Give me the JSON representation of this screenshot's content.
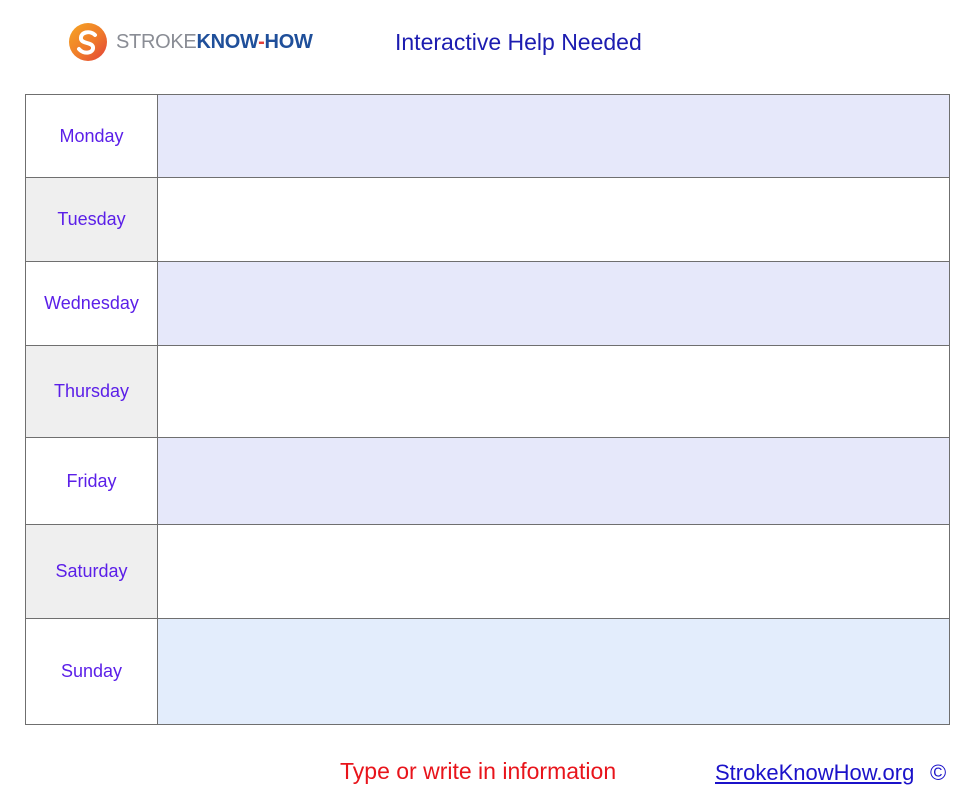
{
  "header": {
    "logo": {
      "stroke": "STROKE",
      "know": "KNOW",
      "dash": "-",
      "how": "HOW"
    },
    "title": "Interactive Help Needed"
  },
  "planner": {
    "days": [
      {
        "label": "Monday"
      },
      {
        "label": "Tuesday"
      },
      {
        "label": "Wednesday"
      },
      {
        "label": "Thursday"
      },
      {
        "label": "Friday"
      },
      {
        "label": "Saturday"
      },
      {
        "label": "Sunday"
      }
    ]
  },
  "footer": {
    "instruction": "Type or write in information",
    "link": "StrokeKnowHow.org",
    "copyright": "©"
  },
  "colors": {
    "title": "#1c1cb0",
    "day_label": "#5b1fe8",
    "instruction": "#e8141b",
    "link": "#1b12c9",
    "row_lavender": "#e6e8fa",
    "row_blue": "#e3edfc",
    "day_grey": "#efefef",
    "logo_orange": "#f08a24",
    "logo_red": "#e2403a",
    "logo_navy": "#1f4f9a"
  }
}
